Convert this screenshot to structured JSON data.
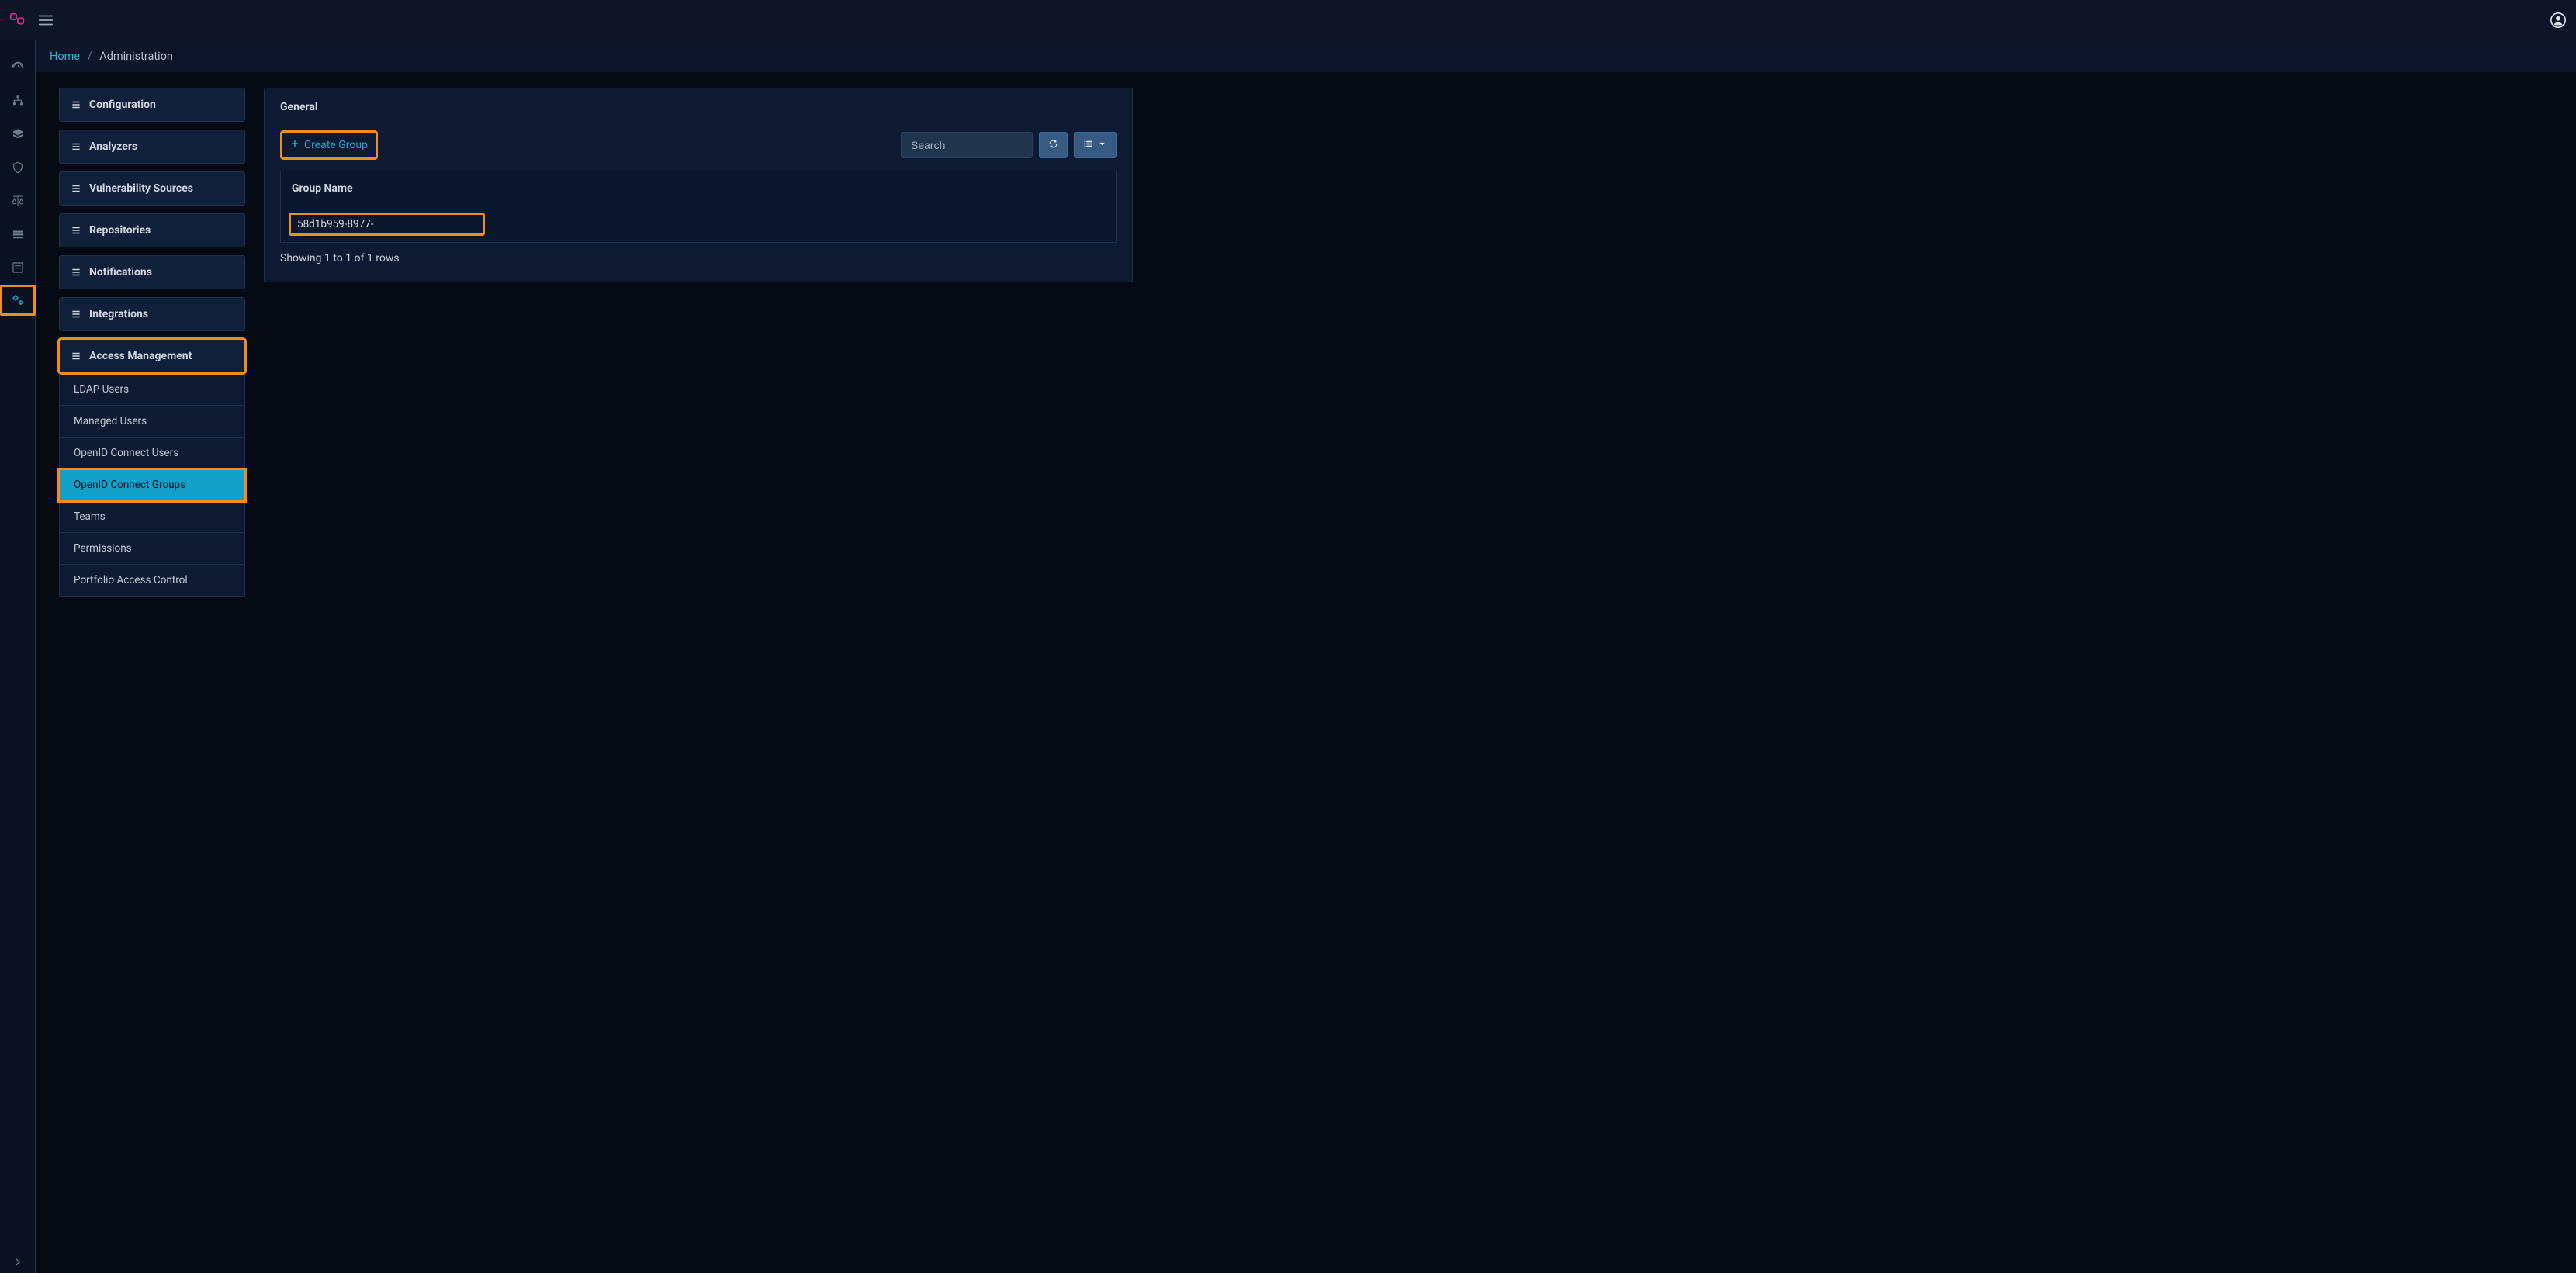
{
  "breadcrumb": {
    "home": "Home",
    "current": "Administration"
  },
  "nav": {
    "configuration": "Configuration",
    "analyzers": "Analyzers",
    "vulnerability_sources": "Vulnerability Sources",
    "repositories": "Repositories",
    "notifications": "Notifications",
    "integrations": "Integrations",
    "access_management": "Access Management",
    "sub": {
      "ldap_users": "LDAP Users",
      "managed_users": "Managed Users",
      "openid_users": "OpenID Connect Users",
      "openid_groups": "OpenID Connect Groups",
      "teams": "Teams",
      "permissions": "Permissions",
      "portfolio_access": "Portfolio Access Control"
    }
  },
  "panel": {
    "title": "General",
    "create_group": "Create Group",
    "search_placeholder": "Search",
    "column_group_name": "Group Name",
    "row_group_name": "58d1b959-8977-",
    "footer": "Showing 1 to 1 of 1 rows"
  }
}
